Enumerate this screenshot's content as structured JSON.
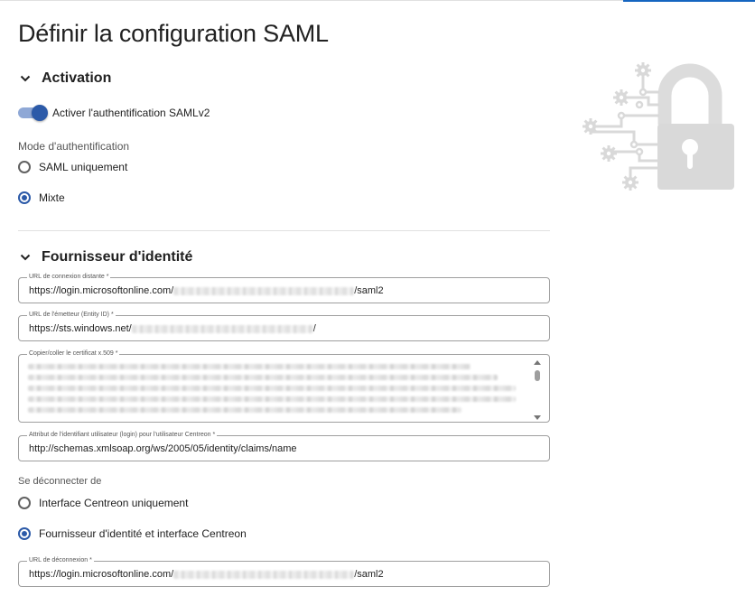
{
  "page": {
    "title": "Définir la configuration SAML"
  },
  "activation": {
    "section_title": "Activation",
    "toggle_label": "Activer l'authentification SAMLv2",
    "toggle_on": true,
    "mode_label": "Mode d'authentification",
    "mode_options": [
      {
        "label": "SAML uniquement",
        "selected": false
      },
      {
        "label": "Mixte",
        "selected": true
      }
    ]
  },
  "identity_provider": {
    "section_title": "Fournisseur d'identité",
    "login_url": {
      "label": "URL de connexion distante *",
      "value_prefix": "https://login.microsoftonline.com/",
      "value_suffix": "/saml2"
    },
    "issuer_url": {
      "label": "URL de l'émetteur (Entity ID) *",
      "value_prefix": "https://sts.windows.net/",
      "value_suffix": "/"
    },
    "certificate": {
      "label": "Copier/coller le certificat x.509 *"
    },
    "user_attribute": {
      "label": "Attribut de l'identifiant utilisateur (login) pour l'utilisateur Centreon *",
      "value": "http://schemas.xmlsoap.org/ws/2005/05/identity/claims/name"
    },
    "logout_label": "Se déconnecter de",
    "logout_options": [
      {
        "label": "Interface Centreon uniquement",
        "selected": false
      },
      {
        "label": "Fournisseur d'identité et interface Centreon",
        "selected": true
      }
    ],
    "logout_url": {
      "label": "URL de déconnexion *",
      "value_prefix": "https://login.microsoftonline.com/",
      "value_suffix": "/saml2"
    }
  },
  "colors": {
    "accent": "#2c5aa8",
    "illustration": "#d9d9d9"
  },
  "icons": {
    "section_toggle": "chevron-down-icon",
    "illustration": "padlock-circuit-icon"
  }
}
